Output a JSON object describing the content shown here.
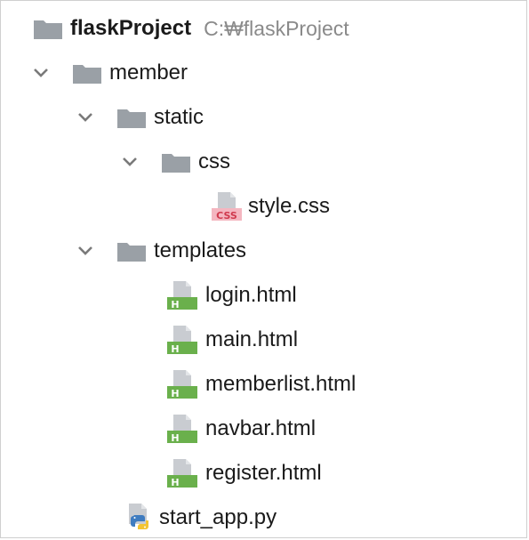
{
  "tree": {
    "root": {
      "name": "flaskProject",
      "path": "C:₩flaskProject",
      "icon": "folder-icon"
    },
    "items": [
      {
        "label": "member",
        "type": "folder",
        "expanded": true,
        "icon": "folder-icon"
      },
      {
        "label": "static",
        "type": "folder",
        "expanded": true,
        "icon": "folder-icon"
      },
      {
        "label": "css",
        "type": "folder",
        "expanded": true,
        "icon": "folder-icon"
      },
      {
        "label": "style.css",
        "type": "file",
        "icon": "css-file-icon",
        "icon_badge": "CSS"
      },
      {
        "label": "templates",
        "type": "folder",
        "expanded": true,
        "icon": "folder-icon"
      },
      {
        "label": "login.html",
        "type": "file",
        "icon": "html-file-icon",
        "icon_badge": "H"
      },
      {
        "label": "main.html",
        "type": "file",
        "icon": "html-file-icon",
        "icon_badge": "H"
      },
      {
        "label": "memberlist.html",
        "type": "file",
        "icon": "html-file-icon",
        "icon_badge": "H"
      },
      {
        "label": "navbar.html",
        "type": "file",
        "icon": "html-file-icon",
        "icon_badge": "H"
      },
      {
        "label": "register.html",
        "type": "file",
        "icon": "html-file-icon",
        "icon_badge": "H"
      },
      {
        "label": "start_app.py",
        "type": "file",
        "icon": "python-file-icon"
      }
    ]
  },
  "colors": {
    "folder": "#9aa0a6",
    "chevron": "#7a7a7a",
    "css_badge_bg": "#f4b6c0",
    "css_badge_text": "#d0394d",
    "html_badge_bg": "#6ab04c",
    "html_badge_text": "#ffffff",
    "file_page": "#c9ccd1",
    "python_blue": "#3f7cc0",
    "python_yellow": "#f2c433"
  }
}
